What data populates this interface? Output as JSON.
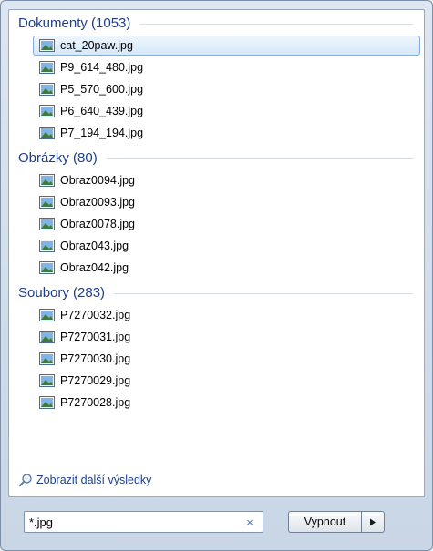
{
  "groups": [
    {
      "title": "Dokumenty (1053)",
      "items": [
        "cat_20paw.jpg",
        "P9_614_480.jpg",
        "P5_570_600.jpg",
        "P6_640_439.jpg",
        "P7_194_194.jpg"
      ]
    },
    {
      "title": "Obrázky (80)",
      "items": [
        "Obraz0094.jpg",
        "Obraz0093.jpg",
        "Obraz0078.jpg",
        "Obraz043.jpg",
        "Obraz042.jpg"
      ]
    },
    {
      "title": "Soubory (283)",
      "items": [
        "P7270032.jpg",
        "P7270031.jpg",
        "P7270030.jpg",
        "P7270029.jpg",
        "P7270028.jpg"
      ]
    }
  ],
  "more_results": "Zobrazit další výsledky",
  "search": {
    "value": "*.jpg"
  },
  "clear_symbol": "×",
  "shutdown_label": "Vypnout",
  "icons": {
    "file": "image-file-icon",
    "more": "search-icon",
    "clear": "close-icon",
    "arrow": "triangle-right-icon"
  },
  "colors": {
    "group_title": "#1e3f8a",
    "selection_border": "#84acdd"
  }
}
